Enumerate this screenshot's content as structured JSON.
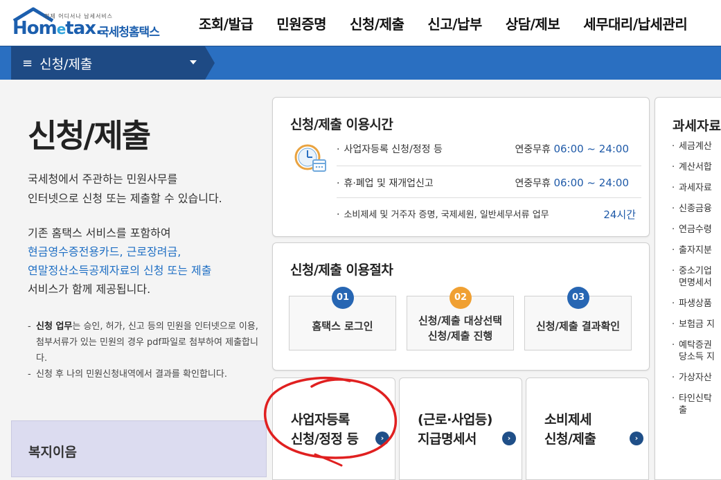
{
  "logo": {
    "sub": "언제 어디서나 납세서비스",
    "main_a": "Hom",
    "main_e": "e",
    "main_b": "tax.",
    "kr": "국세청홈택스"
  },
  "topnav": [
    "조회/발급",
    "민원증명",
    "신청/제출",
    "신고/납부",
    "상담/제보",
    "세무대리/납세관리"
  ],
  "menu": {
    "label": "신청/제출"
  },
  "page": {
    "title": "신청/제출",
    "intro_line1": "국세청에서 주관하는 민원사무를",
    "intro_line2": "인터넷으로 신청 또는 제출할 수 있습니다.",
    "intro2_line1": "기존 홈택스 서비스를 포함하여",
    "intro2_blue1": "현금영수증전용카드, 근로장려금,",
    "intro2_blue2": "연말정산소득공제자료의 신청 또는 제출",
    "intro2_line4": "서비스가 함께 제공됩니다.",
    "note1_bold": "신청 업무",
    "note1_rest": "는 승인, 허가, 신고 등의 민원을 인터넷으로 이용, 첨부서류가 있는 민원의 경우 pdf파일로 첨부하여 제출합니다.",
    "note2": "신청 후 나의 민원신청내역에서 결과를 확인합니다.",
    "welfare": "복지이음"
  },
  "hours": {
    "title": "신청/제출 이용시간",
    "rows": [
      {
        "label": "사업자등록 신청/정정 등",
        "prefix": "연중무휴",
        "time": "06:00 ~ 24:00"
      },
      {
        "label": "휴·폐업 및 재개업신고",
        "prefix": "연중무휴",
        "time": "06:00 ~ 24:00"
      },
      {
        "label": "소비제세 및 거주자 증명, 국제세원, 일반세무서류 업무",
        "prefix": "",
        "time": "24시간"
      }
    ]
  },
  "procedure": {
    "title": "신청/제출 이용절차",
    "steps": [
      {
        "num": "01",
        "line1": "홈택스 로그인",
        "line2": "",
        "color": "#2766b3"
      },
      {
        "num": "02",
        "line1": "신청/제출 대상선택",
        "line2": "신청/제출 진행",
        "color": "#f0a032"
      },
      {
        "num": "03",
        "line1": "신청/제출 결과확인",
        "line2": "",
        "color": "#2766b3"
      }
    ]
  },
  "cards": [
    {
      "line1": "사업자등록",
      "line2": "신청/정정 등"
    },
    {
      "line1": "(근로·사업등)",
      "line2": "지급명세서"
    },
    {
      "line1": "소비제세",
      "line2": "신청/제출"
    }
  ],
  "go_glyph": "›",
  "right_panel": {
    "title": "과세자료",
    "items": [
      "세금계산",
      "계산서합",
      "과세자료",
      "신종금융",
      "연금수령",
      "출자지분",
      "중소기업",
      "면명세서",
      "파생상품",
      "보험금 지",
      "예탁증권",
      "당소득 지",
      "가상자산",
      "타인신탁",
      "출"
    ]
  },
  "colors": {
    "brand": "#1c5fae",
    "bar": "#2a6fc1",
    "menu_tab": "#1e4a84",
    "annotation": "#e02020"
  }
}
